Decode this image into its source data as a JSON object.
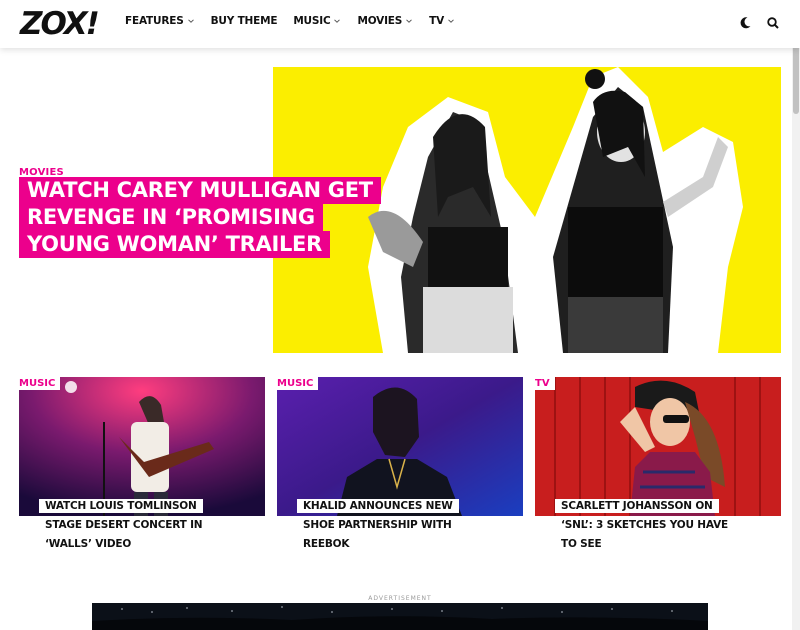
{
  "header": {
    "logo": "ZOX!",
    "nav": [
      {
        "label": "FEATURES",
        "has_dropdown": true
      },
      {
        "label": "BUY THEME",
        "has_dropdown": false
      },
      {
        "label": "MUSIC",
        "has_dropdown": true
      },
      {
        "label": "MOVIES",
        "has_dropdown": true
      },
      {
        "label": "TV",
        "has_dropdown": true
      }
    ],
    "icons": [
      "moon-icon",
      "search-icon"
    ]
  },
  "hero": {
    "category": "MOVIES",
    "title_lines": [
      "WATCH CAREY MULLIGAN GET",
      "REVENGE IN ‘PROMISING",
      "YOUNG WOMAN’ TRAILER"
    ]
  },
  "cards": [
    {
      "category": "MUSIC",
      "title_lines": [
        "WATCH LOUIS TOMLINSON",
        "STAGE DESERT CONCERT IN",
        "‘WALLS’ VIDEO"
      ]
    },
    {
      "category": "MUSIC",
      "title_lines": [
        "KHALID ANNOUNCES NEW",
        "SHOE PARTNERSHIP WITH",
        "REEBOK"
      ]
    },
    {
      "category": "TV",
      "title_lines": [
        "SCARLETT JOHANSSON ON",
        "‘SNL’: 3 SKETCHES YOU HAVE",
        "TO SEE"
      ]
    }
  ],
  "ad": {
    "label": "ADVERTISEMENT"
  },
  "colors": {
    "accent": "#ec008c",
    "hero_bg": "#fbee00"
  }
}
